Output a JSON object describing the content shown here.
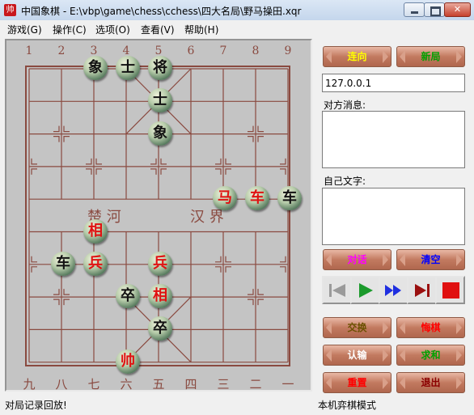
{
  "window": {
    "title": "中国象棋 - E:\\vbp\\game\\chess\\cchess\\四大名局\\野马操田.xqr",
    "icon": "chess-app-icon"
  },
  "menu": [
    "游戏(G)",
    "操作(C)",
    "选项(O)",
    "查看(V)",
    "帮助(H)"
  ],
  "board": {
    "top_labels": [
      "1",
      "2",
      "3",
      "4",
      "5",
      "6",
      "7",
      "8",
      "9"
    ],
    "bottom_labels": [
      "九",
      "八",
      "七",
      "六",
      "五",
      "四",
      "三",
      "二",
      "一"
    ],
    "river_left": "楚  河",
    "river_right": "汉  界",
    "pieces": [
      {
        "char": "象",
        "side": "black",
        "file": 3,
        "rank": 0
      },
      {
        "char": "士",
        "side": "black",
        "file": 4,
        "rank": 0
      },
      {
        "char": "将",
        "side": "black",
        "file": 5,
        "rank": 0
      },
      {
        "char": "士",
        "side": "black",
        "file": 5,
        "rank": 1
      },
      {
        "char": "象",
        "side": "black",
        "file": 5,
        "rank": 2
      },
      {
        "char": "马",
        "side": "red",
        "file": 7,
        "rank": 4
      },
      {
        "char": "车",
        "side": "red",
        "file": 8,
        "rank": 4
      },
      {
        "char": "车",
        "side": "black",
        "file": 9,
        "rank": 4
      },
      {
        "char": "相",
        "side": "red",
        "file": 3,
        "rank": 5
      },
      {
        "char": "车",
        "side": "black",
        "file": 2,
        "rank": 6
      },
      {
        "char": "兵",
        "side": "red",
        "file": 3,
        "rank": 6
      },
      {
        "char": "兵",
        "side": "red",
        "file": 5,
        "rank": 6
      },
      {
        "char": "卒",
        "side": "black",
        "file": 4,
        "rank": 7
      },
      {
        "char": "相",
        "side": "red",
        "file": 5,
        "rank": 7
      },
      {
        "char": "卒",
        "side": "black",
        "file": 5,
        "rank": 8
      },
      {
        "char": "帅",
        "side": "red",
        "file": 4,
        "rank": 9
      }
    ]
  },
  "panel": {
    "connect_btn": "连向",
    "newgame_btn": "新局",
    "ip": "127.0.0.1",
    "peer_msg_label": "对方消息:",
    "own_text_label": "自己文字:",
    "chat_btn": "对话",
    "clear_btn": "清空",
    "media": [
      "first-icon",
      "play-icon",
      "fast-forward-icon",
      "last-icon",
      "stop-icon"
    ],
    "swap_btn": "交换",
    "undo_btn": "悔棋",
    "resign_btn": "认输",
    "draw_btn": "求和",
    "reset_btn": "重置",
    "exit_btn": "退出"
  },
  "status": {
    "left": "对局记录回放!",
    "right": "本机弈棋模式"
  },
  "colors": {
    "board_line": "#8a4a40",
    "red_piece_text": "#e01212",
    "black_piece_text": "#111111",
    "button_face": "#c27a60",
    "btn_yellow": "#ffff00",
    "btn_green": "#00a000",
    "btn_magenta": "#ff00ff",
    "btn_blue": "#0000ff",
    "btn_olive": "#6b5000",
    "btn_red": "#ff0000",
    "btn_darkred": "#8b0000"
  }
}
